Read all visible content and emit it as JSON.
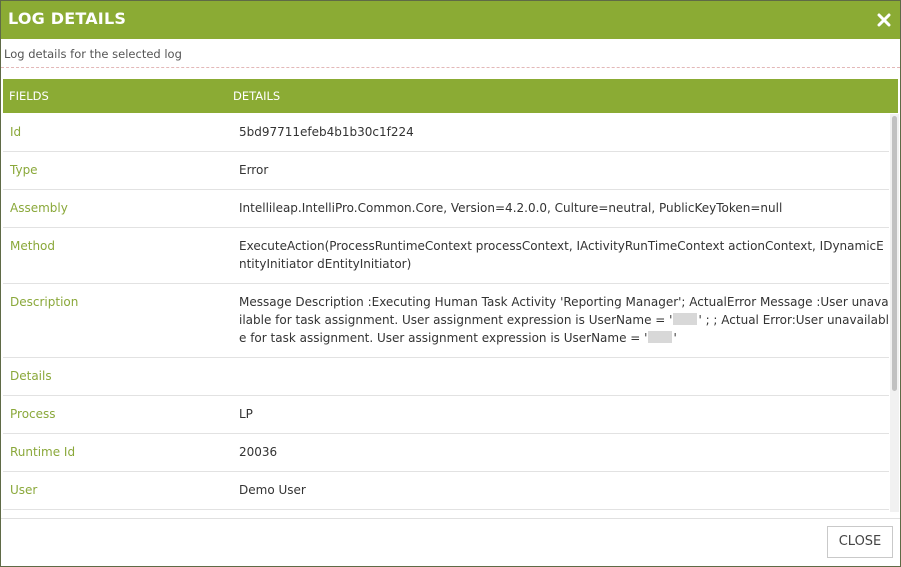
{
  "dialog": {
    "title": "LOG DETAILS",
    "close_icon": "close-icon",
    "subtitle": "Log details for the selected log",
    "accent_color": "#8bab34"
  },
  "table": {
    "headers": {
      "field": "FIELDS",
      "details": "DETAILS"
    },
    "rows": [
      {
        "field": "Id",
        "value": "5bd97711efeb4b1b30c1f224"
      },
      {
        "field": "Type",
        "value": "Error"
      },
      {
        "field": "Assembly",
        "value": "Intellileap.IntelliPro.Common.Core, Version=4.2.0.0, Culture=neutral, PublicKeyToken=null"
      },
      {
        "field": "Method",
        "value": "ExecuteAction(ProcessRuntimeContext processContext, IActivityRunTimeContext actionContext, IDynamicEntityInitiator dEntityInitiator)"
      },
      {
        "field": "Description",
        "value_part1": "Message Description :Executing Human Task Activity 'Reporting Manager'; ActualError Message :User unavailable for task assignment. User assignment expression is UserName = '",
        "value_part2": "' ; ; Actual Error:User unavailable for task assignment. User assignment expression is UserName = '",
        "value_part3": "'"
      },
      {
        "field": "Details",
        "value": ""
      },
      {
        "field": "Process",
        "value": "LP"
      },
      {
        "field": "Runtime Id",
        "value": "20036"
      },
      {
        "field": "User",
        "value": "Demo User"
      }
    ]
  },
  "footer": {
    "close_label": "CLOSE"
  }
}
